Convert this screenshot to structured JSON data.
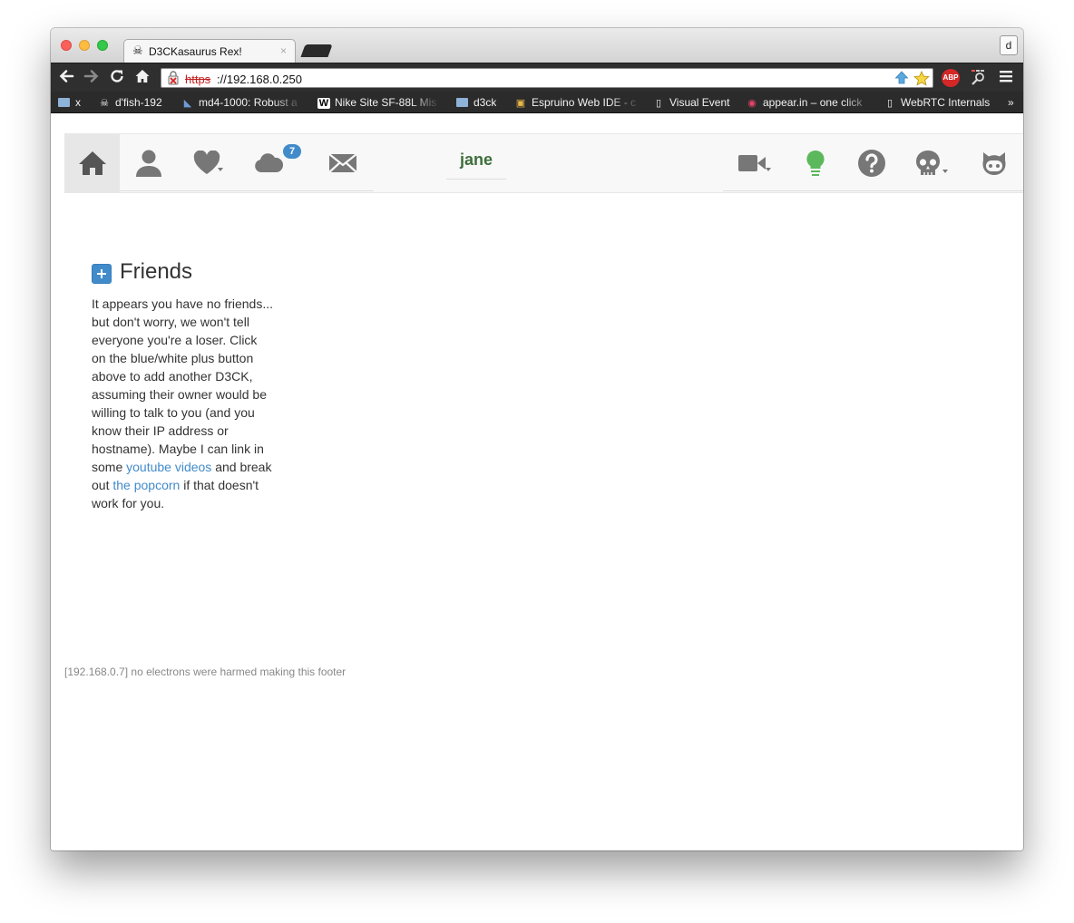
{
  "browser": {
    "tab_title": "D3CKasaurus Rex!",
    "tab_close": "×",
    "profile_letter": "d",
    "url_scheme": "https",
    "url_rest": "://192.168.0.250",
    "abp_label": "ABP"
  },
  "bookmarks": [
    {
      "label": "x",
      "icon": "folder-icon"
    },
    {
      "label": "d'fish-192",
      "icon": "skull-icon"
    },
    {
      "label": "md4-1000: Robust a",
      "icon": "page-icon"
    },
    {
      "label": "Nike Site SF-88L Mis",
      "icon": "wikipedia-icon"
    },
    {
      "label": "d3ck",
      "icon": "folder-icon"
    },
    {
      "label": "Espruino Web IDE - c",
      "icon": "app-icon"
    },
    {
      "label": "Visual Event",
      "icon": "document-icon"
    },
    {
      "label": "appear.in – one click",
      "icon": "appear-icon"
    },
    {
      "label": "WebRTC Internals",
      "icon": "document-icon"
    }
  ],
  "bookmarks_more": "»",
  "navbar": {
    "brand": "jane",
    "cloud_badge": "7",
    "accent_color": "#428bca",
    "brand_color": "#3d6e3a",
    "bulb_color": "#5cb85c"
  },
  "friends": {
    "title": "Friends",
    "text_before_link1": "It appears you have no friends... but don't worry, we won't tell everyone you're a loser. Click on the blue/white plus button above to add another D3CK, assuming their owner would be willing to talk to you (and you know their IP address or hostname). Maybe I can link in some ",
    "link1": "youtube videos",
    "text_between": " and break out ",
    "link2": "the popcorn",
    "text_after": " if that doesn't work for you."
  },
  "footer": "[192.168.0.7] no electrons were harmed making this footer"
}
